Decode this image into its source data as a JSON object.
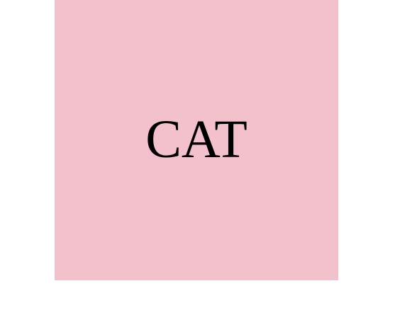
{
  "card": {
    "label": "CAT",
    "background_color": "#F3C1CB",
    "text_color": "#000000"
  },
  "page": {
    "background_color": "#FFFFFF"
  }
}
